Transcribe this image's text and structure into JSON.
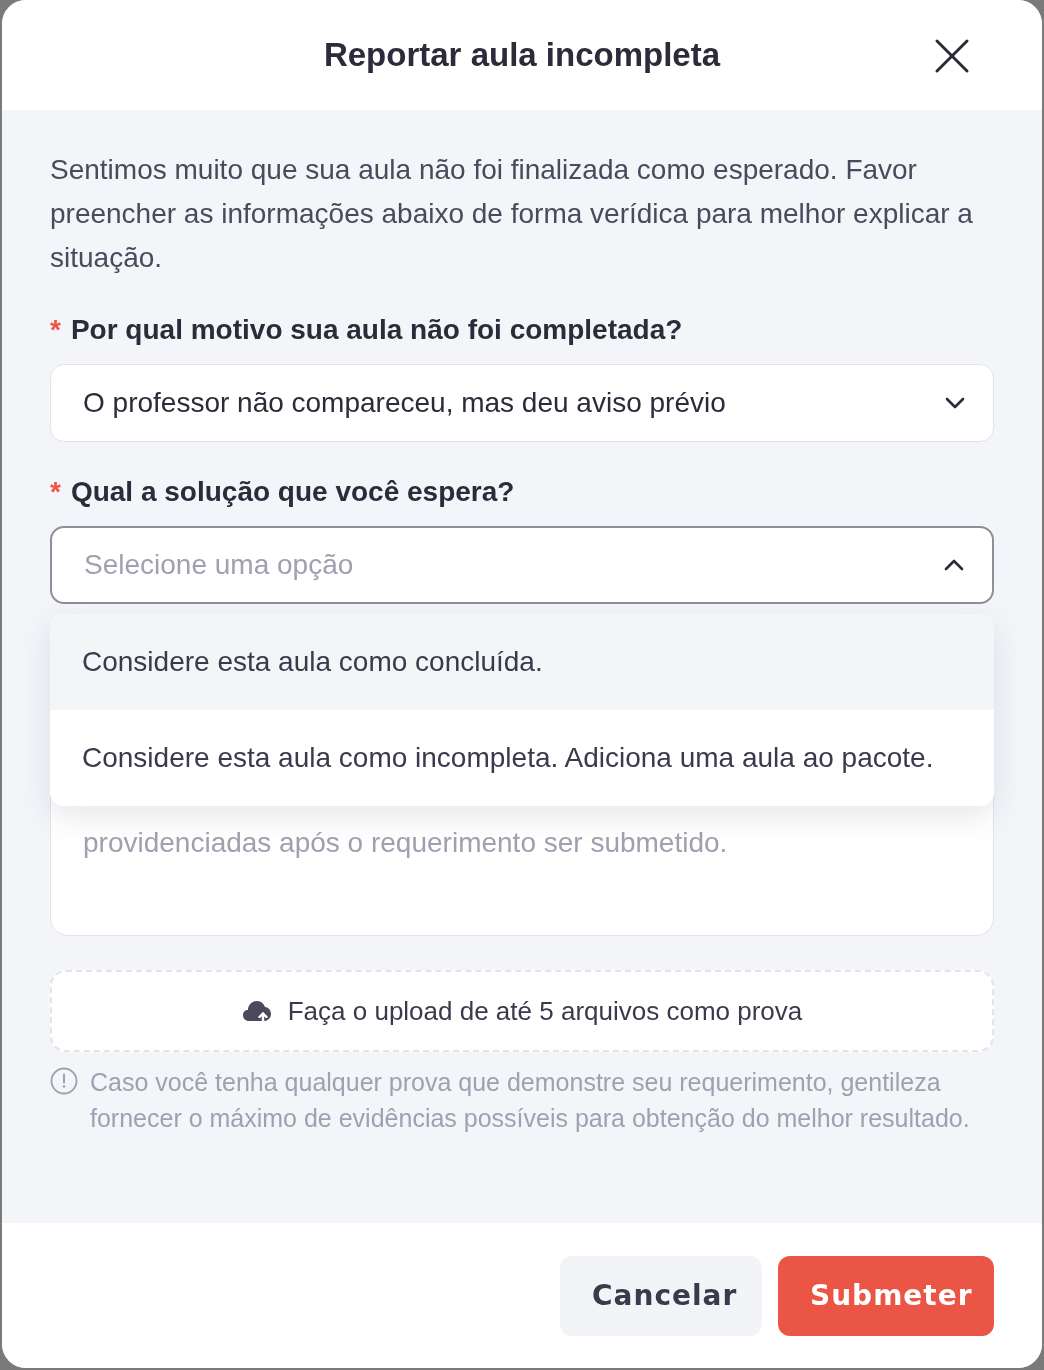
{
  "dialog": {
    "title": "Reportar aula incompleta"
  },
  "intro": "Sentimos muito que sua aula não foi finalizada como esperado. Favor preencher as informações abaixo de forma verídica para melhor explicar a situação.",
  "fields": [
    {
      "kind": "select",
      "required_mark": "*",
      "label": "Por qual motivo sua aula não foi completada?",
      "value": "O professor não compareceu, mas deu aviso prévio",
      "expanded": false
    },
    {
      "kind": "select",
      "required_mark": "*",
      "label": "Qual a solução que você espera?",
      "placeholder": "Selecione uma opção",
      "expanded": true,
      "options": [
        {
          "label": "Considere esta aula como concluída.",
          "highlighted": true
        },
        {
          "label": "Considere esta aula como incompleta. Adiciona uma aula ao pacote.",
          "highlighted": false
        }
      ]
    },
    {
      "kind": "textarea",
      "placeholder": "providenciadas após o requerimento ser submetido."
    }
  ],
  "upload": {
    "label": "Faça o upload de até 5 arquivos como prova"
  },
  "hint": "Caso você tenha qualquer prova que demonstre seu requerimento, gentileza fornecer o máximo de evidências possíveis para obtenção do melhor resultado.",
  "buttons": [
    {
      "label": "Cancelar",
      "kind": "secondary"
    },
    {
      "label": "Submeter",
      "kind": "primary"
    }
  ]
}
